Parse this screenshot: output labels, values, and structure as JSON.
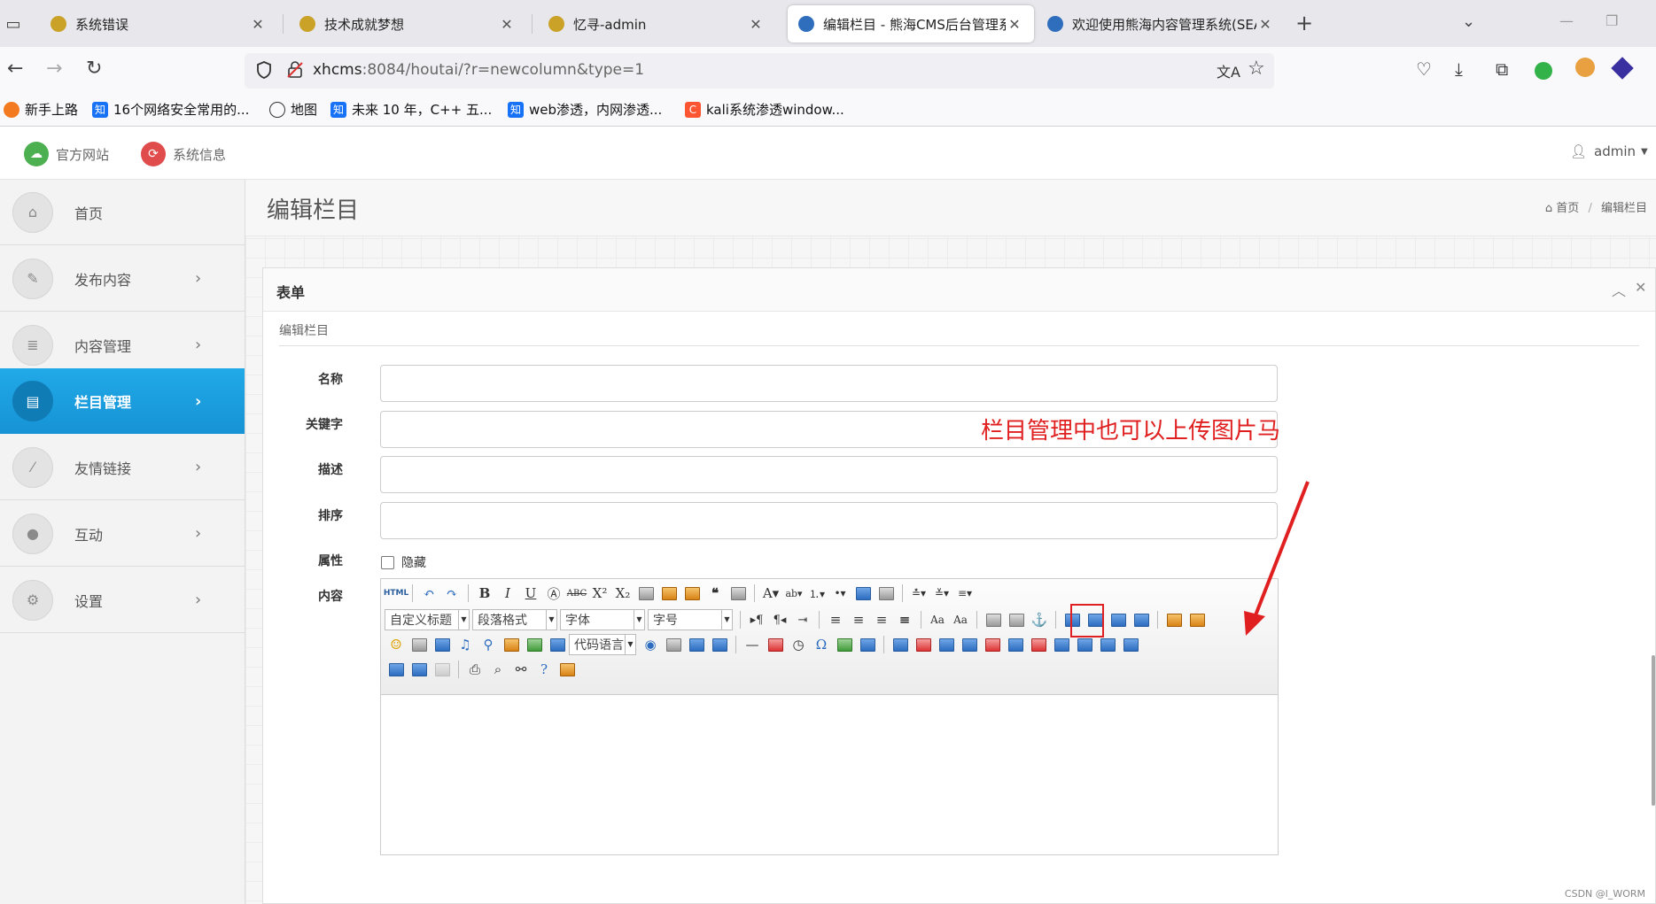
{
  "browser": {
    "tabs": [
      {
        "title": "系统错误",
        "active": false
      },
      {
        "title": "技术成就梦想",
        "active": false
      },
      {
        "title": "忆寻-admin",
        "active": false
      },
      {
        "title": "编辑栏目 - 熊海CMS后台管理系",
        "active": true
      },
      {
        "title": "欢迎使用熊海内容管理系统(SEA",
        "active": false
      }
    ],
    "url_host": "xhcms",
    "url_rest": ":8084/houtai/?r=newcolumn&type=1",
    "bookmarks": [
      {
        "label": "新手上路",
        "icon": "firefox-icon"
      },
      {
        "label": "16个网络安全常用的...",
        "icon": "zhihu-icon",
        "badge": "知"
      },
      {
        "label": "地图",
        "icon": "globe-icon"
      },
      {
        "label": "未来 10 年，C++ 五...",
        "icon": "zhihu-icon",
        "badge": "知"
      },
      {
        "label": "web渗透，内网渗透...",
        "icon": "zhihu-icon",
        "badge": "知"
      },
      {
        "label": "kali系统渗透window...",
        "icon": "csdn-icon",
        "badge": "C"
      }
    ]
  },
  "header": {
    "official_site": "官方网站",
    "system_info": "系统信息",
    "user": "admin"
  },
  "sidebar": {
    "items": [
      {
        "label": "首页",
        "icon": "home-icon",
        "has_arrow": false,
        "active": false
      },
      {
        "label": "发布内容",
        "icon": "pencil-icon",
        "has_arrow": true,
        "active": false
      },
      {
        "label": "内容管理",
        "icon": "list-icon",
        "has_arrow": true,
        "active": false
      },
      {
        "label": "栏目管理",
        "icon": "column-icon",
        "has_arrow": true,
        "active": true
      },
      {
        "label": "友情链接",
        "icon": "wand-icon",
        "has_arrow": true,
        "active": false
      },
      {
        "label": "互动",
        "icon": "chat-icon",
        "has_arrow": true,
        "active": false
      },
      {
        "label": "设置",
        "icon": "cogs-icon",
        "has_arrow": true,
        "active": false
      }
    ]
  },
  "page": {
    "title": "编辑栏目",
    "breadcrumb": [
      "首页",
      "编辑栏目"
    ],
    "panel_title": "表单",
    "section_title": "编辑栏目"
  },
  "form": {
    "name_label": "名称",
    "keywords_label": "关键字",
    "desc_label": "描述",
    "order_label": "排序",
    "attr_label": "属性",
    "hidden_label": "隐藏",
    "content_label": "内容"
  },
  "editor": {
    "combos": {
      "custom_title": "自定义标题",
      "paragraph": "段落格式",
      "font": "字体",
      "size": "字号",
      "code_lang": "代码语言"
    }
  },
  "annotation": {
    "text": "栏目管理中也可以上传图片马",
    "color": "#e02020"
  },
  "watermark": "CSDN @l_WORM",
  "colors": {
    "accent": "#1a9ee0",
    "sidebar_bg": "#f3f3f3"
  }
}
